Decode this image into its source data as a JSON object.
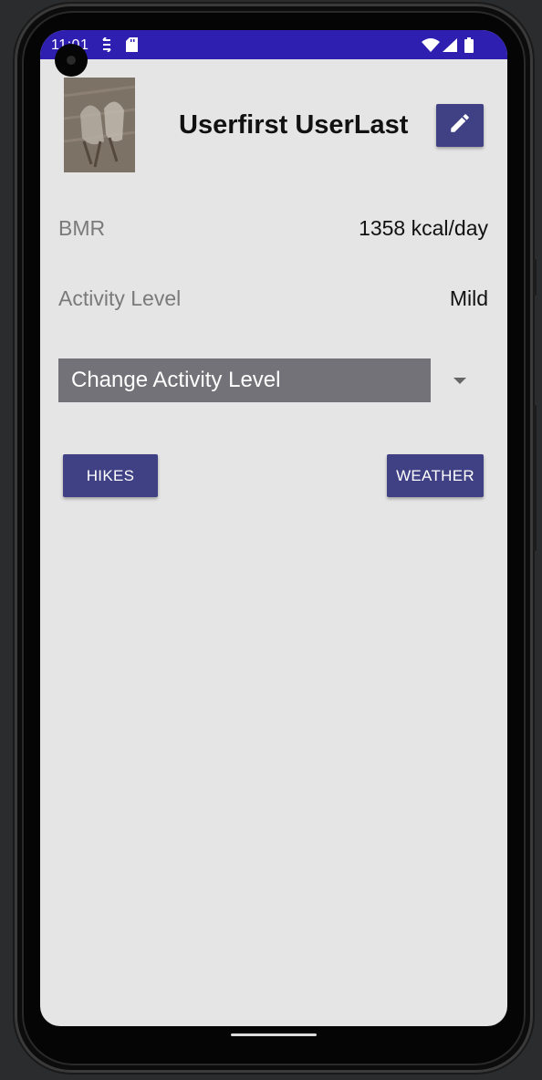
{
  "status_bar": {
    "time": "11:01",
    "icons": [
      "sync-icon",
      "sd-card-icon",
      "wifi-icon",
      "signal-icon",
      "battery-icon"
    ]
  },
  "profile": {
    "name": "Userfirst UserLast",
    "edit_icon": "pencil-icon"
  },
  "stats": {
    "bmr_label": "BMR",
    "bmr_value": "1358 kcal/day",
    "activity_label": "Activity Level",
    "activity_value": "Mild"
  },
  "spinner": {
    "selected": "Change Activity Level",
    "icon": "dropdown-arrow-icon"
  },
  "buttons": {
    "hikes": "HIKES",
    "weather": "WEATHER"
  },
  "colors": {
    "status_bar": "#2f1fb1",
    "accent": "#3f4184",
    "background": "#e5e5e5",
    "spinner": "#727278"
  }
}
